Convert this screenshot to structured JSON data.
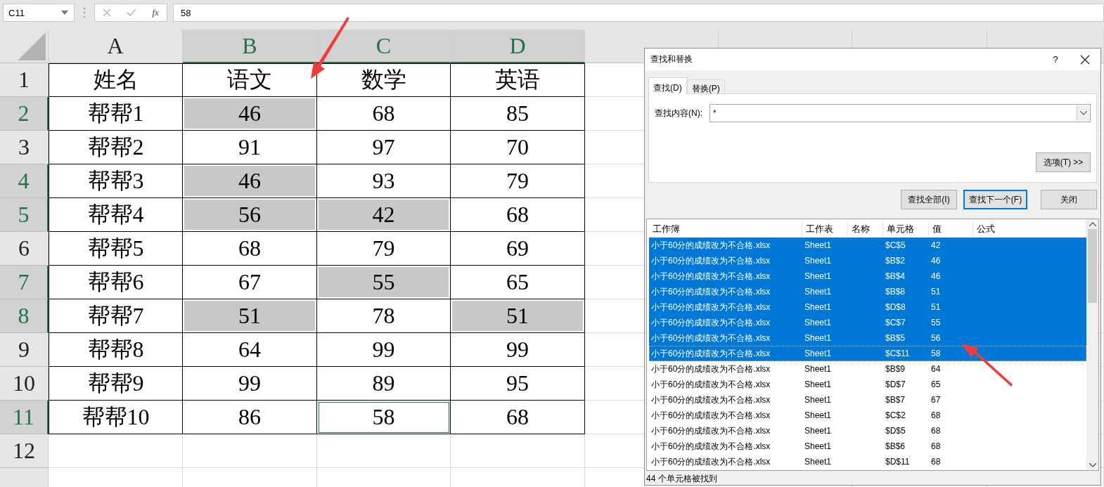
{
  "formula_bar": {
    "name_box": "C11",
    "fx_label": "fx",
    "formula": "58"
  },
  "sheet": {
    "columns": [
      {
        "label": "A",
        "highlighted": false
      },
      {
        "label": "B",
        "highlighted": true
      },
      {
        "label": "C",
        "highlighted": true
      },
      {
        "label": "D",
        "highlighted": true
      }
    ],
    "rows": [
      {
        "number": "1",
        "highlighted": false,
        "cells": [
          {
            "text": "姓名",
            "highlighted": false,
            "selected": false
          },
          {
            "text": "语文",
            "highlighted": false,
            "selected": false
          },
          {
            "text": "数学",
            "highlighted": false,
            "selected": false
          },
          {
            "text": "英语",
            "highlighted": false,
            "selected": false
          }
        ]
      },
      {
        "number": "2",
        "highlighted": true,
        "cells": [
          {
            "text": "帮帮1",
            "highlighted": false,
            "selected": false
          },
          {
            "text": "46",
            "highlighted": true,
            "selected": false
          },
          {
            "text": "68",
            "highlighted": false,
            "selected": false
          },
          {
            "text": "85",
            "highlighted": false,
            "selected": false
          }
        ]
      },
      {
        "number": "3",
        "highlighted": false,
        "cells": [
          {
            "text": "帮帮2",
            "highlighted": false,
            "selected": false
          },
          {
            "text": "91",
            "highlighted": false,
            "selected": false
          },
          {
            "text": "97",
            "highlighted": false,
            "selected": false
          },
          {
            "text": "70",
            "highlighted": false,
            "selected": false
          }
        ]
      },
      {
        "number": "4",
        "highlighted": true,
        "cells": [
          {
            "text": "帮帮3",
            "highlighted": false,
            "selected": false
          },
          {
            "text": "46",
            "highlighted": true,
            "selected": false
          },
          {
            "text": "93",
            "highlighted": false,
            "selected": false
          },
          {
            "text": "79",
            "highlighted": false,
            "selected": false
          }
        ]
      },
      {
        "number": "5",
        "highlighted": true,
        "cells": [
          {
            "text": "帮帮4",
            "highlighted": false,
            "selected": false
          },
          {
            "text": "56",
            "highlighted": true,
            "selected": false
          },
          {
            "text": "42",
            "highlighted": true,
            "selected": false
          },
          {
            "text": "68",
            "highlighted": false,
            "selected": false
          }
        ]
      },
      {
        "number": "6",
        "highlighted": false,
        "cells": [
          {
            "text": "帮帮5",
            "highlighted": false,
            "selected": false
          },
          {
            "text": "68",
            "highlighted": false,
            "selected": false
          },
          {
            "text": "79",
            "highlighted": false,
            "selected": false
          },
          {
            "text": "69",
            "highlighted": false,
            "selected": false
          }
        ]
      },
      {
        "number": "7",
        "highlighted": true,
        "cells": [
          {
            "text": "帮帮6",
            "highlighted": false,
            "selected": false
          },
          {
            "text": "67",
            "highlighted": false,
            "selected": false
          },
          {
            "text": "55",
            "highlighted": true,
            "selected": false
          },
          {
            "text": "65",
            "highlighted": false,
            "selected": false
          }
        ]
      },
      {
        "number": "8",
        "highlighted": true,
        "cells": [
          {
            "text": "帮帮7",
            "highlighted": false,
            "selected": false
          },
          {
            "text": "51",
            "highlighted": true,
            "selected": false
          },
          {
            "text": "78",
            "highlighted": false,
            "selected": false
          },
          {
            "text": "51",
            "highlighted": true,
            "selected": false
          }
        ]
      },
      {
        "number": "9",
        "highlighted": false,
        "cells": [
          {
            "text": "帮帮8",
            "highlighted": false,
            "selected": false
          },
          {
            "text": "64",
            "highlighted": false,
            "selected": false
          },
          {
            "text": "99",
            "highlighted": false,
            "selected": false
          },
          {
            "text": "99",
            "highlighted": false,
            "selected": false
          }
        ]
      },
      {
        "number": "10",
        "highlighted": false,
        "cells": [
          {
            "text": "帮帮9",
            "highlighted": false,
            "selected": false
          },
          {
            "text": "99",
            "highlighted": false,
            "selected": false
          },
          {
            "text": "89",
            "highlighted": false,
            "selected": false
          },
          {
            "text": "95",
            "highlighted": false,
            "selected": false
          }
        ]
      },
      {
        "number": "11",
        "highlighted": true,
        "cells": [
          {
            "text": "帮帮10",
            "highlighted": false,
            "selected": false
          },
          {
            "text": "86",
            "highlighted": false,
            "selected": false
          },
          {
            "text": "58",
            "highlighted": false,
            "selected": true
          },
          {
            "text": "68",
            "highlighted": false,
            "selected": false
          }
        ]
      },
      {
        "number": "12",
        "highlighted": false,
        "cells": []
      }
    ]
  },
  "dialog": {
    "title": "查找和替换",
    "help": "?",
    "tabs": [
      {
        "label": "查找(D)",
        "selected": true
      },
      {
        "label": "替换(P)",
        "selected": false
      }
    ],
    "find_label": "查找内容(N):",
    "find_value": "*",
    "options_button": "选项(T) >>",
    "buttons": [
      {
        "label": "查找全部(I)",
        "default": false
      },
      {
        "label": "查找下一个(F)",
        "default": true
      },
      {
        "label": "关闭",
        "default": false
      }
    ],
    "results": {
      "columns": [
        "工作簿",
        "工作表",
        "名称",
        "单元格",
        "值",
        "公式"
      ],
      "rows": [
        {
          "workbook": "小于60分的成绩改为不合格.xlsx",
          "sheet": "Sheet1",
          "cell": "$C$5",
          "value": "42",
          "selected": true,
          "focused": false
        },
        {
          "workbook": "小于60分的成绩改为不合格.xlsx",
          "sheet": "Sheet1",
          "cell": "$B$2",
          "value": "46",
          "selected": true,
          "focused": false
        },
        {
          "workbook": "小于60分的成绩改为不合格.xlsx",
          "sheet": "Sheet1",
          "cell": "$B$4",
          "value": "46",
          "selected": true,
          "focused": false
        },
        {
          "workbook": "小于60分的成绩改为不合格.xlsx",
          "sheet": "Sheet1",
          "cell": "$B$8",
          "value": "51",
          "selected": true,
          "focused": false
        },
        {
          "workbook": "小于60分的成绩改为不合格.xlsx",
          "sheet": "Sheet1",
          "cell": "$D$8",
          "value": "51",
          "selected": true,
          "focused": false
        },
        {
          "workbook": "小于60分的成绩改为不合格.xlsx",
          "sheet": "Sheet1",
          "cell": "$C$7",
          "value": "55",
          "selected": true,
          "focused": false
        },
        {
          "workbook": "小于60分的成绩改为不合格.xlsx",
          "sheet": "Sheet1",
          "cell": "$B$5",
          "value": "56",
          "selected": true,
          "focused": false
        },
        {
          "workbook": "小于60分的成绩改为不合格.xlsx",
          "sheet": "Sheet1",
          "cell": "$C$11",
          "value": "58",
          "selected": true,
          "focused": true
        },
        {
          "workbook": "小于60分的成绩改为不合格.xlsx",
          "sheet": "Sheet1",
          "cell": "$B$9",
          "value": "64",
          "selected": false,
          "focused": false
        },
        {
          "workbook": "小于60分的成绩改为不合格.xlsx",
          "sheet": "Sheet1",
          "cell": "$D$7",
          "value": "65",
          "selected": false,
          "focused": false
        },
        {
          "workbook": "小于60分的成绩改为不合格.xlsx",
          "sheet": "Sheet1",
          "cell": "$B$7",
          "value": "67",
          "selected": false,
          "focused": false
        },
        {
          "workbook": "小于60分的成绩改为不合格.xlsx",
          "sheet": "Sheet1",
          "cell": "$C$2",
          "value": "68",
          "selected": false,
          "focused": false
        },
        {
          "workbook": "小于60分的成绩改为不合格.xlsx",
          "sheet": "Sheet1",
          "cell": "$D$5",
          "value": "68",
          "selected": false,
          "focused": false
        },
        {
          "workbook": "小于60分的成绩改为不合格.xlsx",
          "sheet": "Sheet1",
          "cell": "$B$6",
          "value": "68",
          "selected": false,
          "focused": false
        },
        {
          "workbook": "小于60分的成绩改为不合格.xlsx",
          "sheet": "Sheet1",
          "cell": "$D$11",
          "value": "68",
          "selected": false,
          "focused": false
        }
      ]
    },
    "status": "44 个单元格被找到"
  }
}
